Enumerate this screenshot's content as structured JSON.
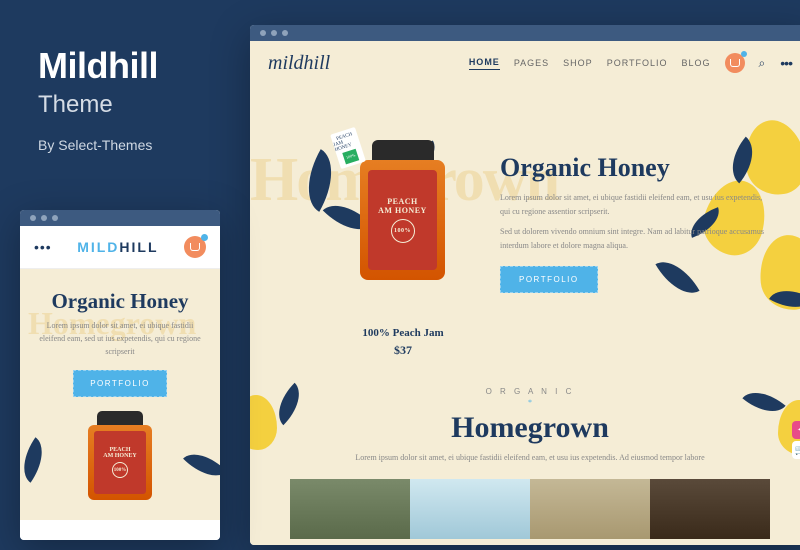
{
  "info": {
    "title": "Mildhill",
    "subtitle": "Theme",
    "author": "By Select-Themes"
  },
  "desktop": {
    "logo": "mildhill",
    "nav": [
      "HOME",
      "PAGES",
      "SHOP",
      "PORTFOLIO",
      "BLOG"
    ],
    "hero": {
      "bg_word": "Homegrown",
      "title": "Organic Honey",
      "desc1": "Lorem ipsum dolor sit amet, ei ubique fastidii eleifend eam, et usu ius expetendis, qui cu regione assentior scripserit.",
      "desc2": "Sed ut dolorem vivendo omnium sint integre. Nam ad labitur patrioque accusamus interdum labore et dolore magna aliqua.",
      "button": "PORTFOLIO"
    },
    "product": {
      "name": "100% Peach Jam",
      "price": "$37",
      "jar_line1": "PEACH",
      "jar_line2": "AM HONEY",
      "jar_badge": "100%",
      "tag_line1": "PEACH",
      "tag_line2": "JAM HONEY",
      "tag_badge": "100%"
    },
    "section2": {
      "overline": "O R G A N I C",
      "title": "Homegrown",
      "desc": "Lorem ipsum dolor sit amet, ei ubique fastidii eleifend eam, et usu ius expetendis. Ad eiusmod tempor labore"
    }
  },
  "mobile": {
    "logo_pre": "MILD",
    "logo_post": "HILL",
    "hero": {
      "bg_word": "Homegrown",
      "title": "Organic Honey",
      "desc": "Lorem ipsum dolor sit amet, ei ubique fastidii eleifend eam, sed ut ius expetendis, qui cu regione scripserit",
      "button": "PORTFOLIO"
    },
    "jar": {
      "line1": "PEACH",
      "line2": "AM HONEY",
      "badge": "100%"
    }
  }
}
